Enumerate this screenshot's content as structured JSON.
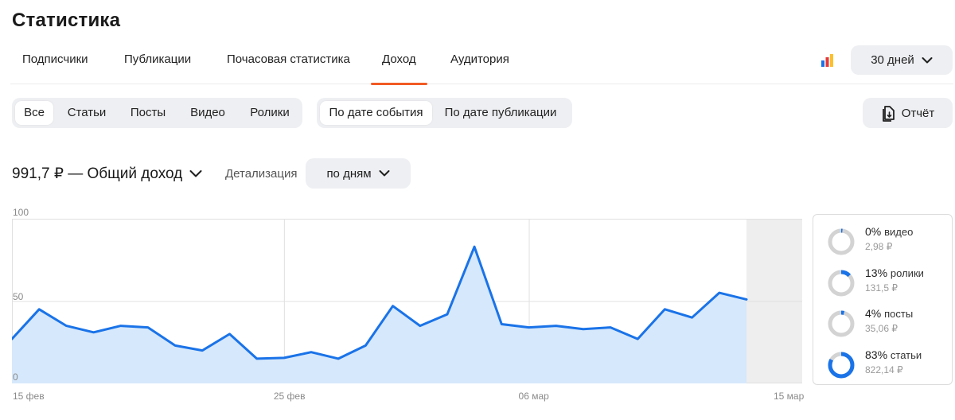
{
  "page": {
    "title": "Статистика"
  },
  "main_tabs": [
    {
      "label": "Подписчики",
      "active": false
    },
    {
      "label": "Публикации",
      "active": false
    },
    {
      "label": "Почасовая статистика",
      "active": false
    },
    {
      "label": "Доход",
      "active": true
    },
    {
      "label": "Аудитория",
      "active": false
    }
  ],
  "period": {
    "label": "30 дней"
  },
  "content_filter": [
    {
      "label": "Все",
      "active": true
    },
    {
      "label": "Статьи",
      "active": false
    },
    {
      "label": "Посты",
      "active": false
    },
    {
      "label": "Видео",
      "active": false
    },
    {
      "label": "Ролики",
      "active": false
    }
  ],
  "date_filter": [
    {
      "label": "По дате события",
      "active": true
    },
    {
      "label": "По дате публикации",
      "active": false
    }
  ],
  "report": {
    "label": "Отчёт"
  },
  "summary": {
    "total_label": "991,7 ₽ — Общий доход"
  },
  "detail": {
    "label": "Детализация",
    "value": "по дням"
  },
  "legend": [
    {
      "pct": "0%",
      "category": "видео",
      "amount": "2,98 ₽",
      "fraction": 0.003
    },
    {
      "pct": "13%",
      "category": "ролики",
      "amount": "131,5 ₽",
      "fraction": 0.13
    },
    {
      "pct": "4%",
      "category": "посты",
      "amount": "35,06 ₽",
      "fraction": 0.04
    },
    {
      "pct": "83%",
      "category": "статьи",
      "amount": "822,14 ₽",
      "fraction": 0.83
    }
  ],
  "colors": {
    "accent": "#f15a24",
    "line": "#1a73e8",
    "area": "#d6e8fb",
    "ring_track": "#d3d3d3",
    "shaded": "#eeeeee"
  },
  "chart_data": {
    "type": "area",
    "x": [
      "15 фев",
      "16 фев",
      "17 фев",
      "18 фев",
      "19 фев",
      "20 фев",
      "21 фев",
      "22 фев",
      "23 фев",
      "24 фев",
      "25 фев",
      "26 фев",
      "27 фев",
      "28 фев",
      "01 мар",
      "02 мар",
      "03 мар",
      "04 мар",
      "05 мар",
      "06 мар",
      "07 мар",
      "08 мар",
      "09 мар",
      "10 мар",
      "11 мар",
      "12 мар",
      "13 мар",
      "14 мар"
    ],
    "values": [
      27,
      45,
      35,
      31,
      35,
      34,
      23,
      20,
      30,
      15,
      15.5,
      19,
      15,
      23,
      47,
      35,
      42,
      83,
      36,
      34,
      35,
      33,
      34,
      27,
      45,
      40,
      55,
      51
    ],
    "x_tick_labels": [
      "15 фев",
      "25 фев",
      "06 мар",
      "15 мар"
    ],
    "y_tick_labels": [
      "100",
      "50",
      "0"
    ],
    "ylim": [
      0,
      100
    ],
    "grid": true,
    "shaded_future": true,
    "title": "",
    "xlabel": "",
    "ylabel": ""
  }
}
